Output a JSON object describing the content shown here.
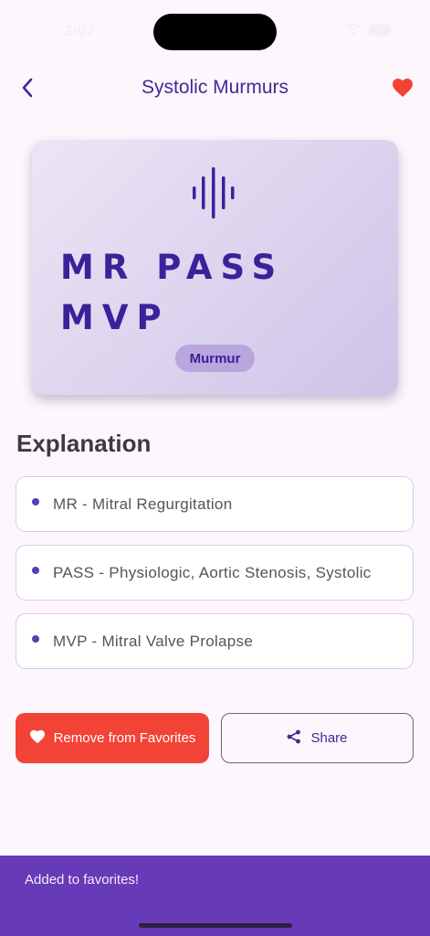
{
  "status_bar": {
    "time": "2:07",
    "icons": [
      "wifi-icon",
      "battery-icon"
    ]
  },
  "header": {
    "title": "Systolic Murmurs",
    "back_icon": "chevron-left-icon",
    "favorite_icon": "heart-filled-icon",
    "favorite_active": true
  },
  "card": {
    "icon": "sound-wave-icon",
    "mnemonic_lines": [
      "MR PASS",
      "MVP"
    ],
    "category": "Murmur"
  },
  "explanation": {
    "heading": "Explanation",
    "items": [
      "MR - Mitral Regurgitation",
      "PASS - Physiologic, Aortic Stenosis, Systolic",
      "MVP - Mitral Valve Prolapse"
    ]
  },
  "actions": {
    "remove_label": "Remove from Favorites",
    "remove_icon": "heart-icon",
    "share_label": "Share",
    "share_icon": "share-icon"
  },
  "snackbar": {
    "message": "Added to favorites!"
  },
  "colors": {
    "primary": "#3f2a96",
    "accent_red": "#f24336",
    "snackbar": "#673ab7",
    "background": "#fdf6fd"
  }
}
